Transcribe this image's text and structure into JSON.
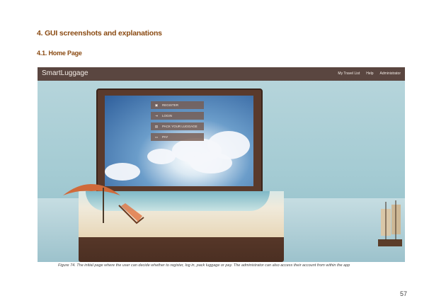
{
  "doc": {
    "heading": "4. GUI screenshots and explanations",
    "subheading": "4.1. Home Page",
    "caption": "Figure 74. The initial page where the user can decide whether to register, log in, pack luggage or pay. The administrator can also access their account from within the app",
    "page_number": "57"
  },
  "app": {
    "brand": "SmartLuggage",
    "nav": [
      "My Travel List",
      "Help",
      "Administrator"
    ],
    "menu": [
      {
        "label": "REGISTER",
        "icon": "id-card-icon",
        "glyph": "▣"
      },
      {
        "label": "LOGIN",
        "icon": "login-icon",
        "glyph": "⇥"
      },
      {
        "label": "PACK YOUR LUGGAGE",
        "icon": "luggage-icon",
        "glyph": "▤"
      },
      {
        "label": "PAY",
        "icon": "credit-card-icon",
        "glyph": "▭"
      }
    ],
    "colors": {
      "navbar": "#5a4640",
      "heading": "#8a4a12"
    }
  }
}
